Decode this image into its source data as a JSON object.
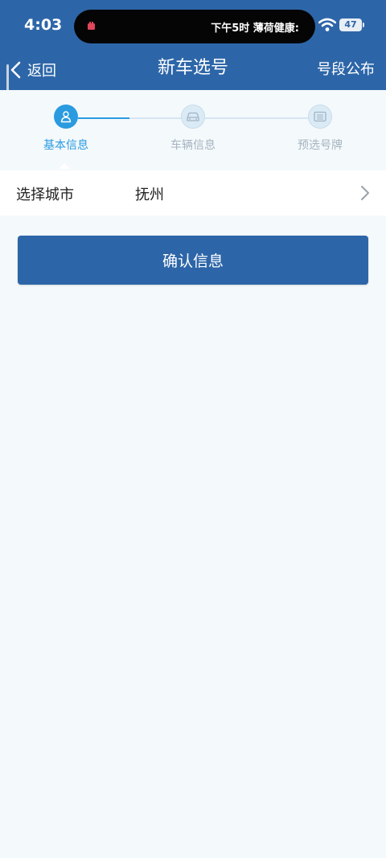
{
  "status_bar": {
    "time": "4:03",
    "notification": "下午5时 薄荷健康:",
    "battery": "47"
  },
  "navbar": {
    "back_label": "返回",
    "title": "新车选号",
    "right_action": "号段公布"
  },
  "steps": [
    {
      "label": "基本信息",
      "icon": "user-icon",
      "active": true
    },
    {
      "label": "车辆信息",
      "icon": "car-icon",
      "active": false
    },
    {
      "label": "预选号牌",
      "icon": "license-plate-icon",
      "active": false
    }
  ],
  "form": {
    "city_label": "选择城市",
    "city_value": "抚州"
  },
  "confirm_label": "确认信息",
  "colors": {
    "primary": "#2d66a8",
    "step_active": "#2a9be0",
    "step_inactive": "#a6b4c0",
    "background": "#f4f9fc"
  }
}
